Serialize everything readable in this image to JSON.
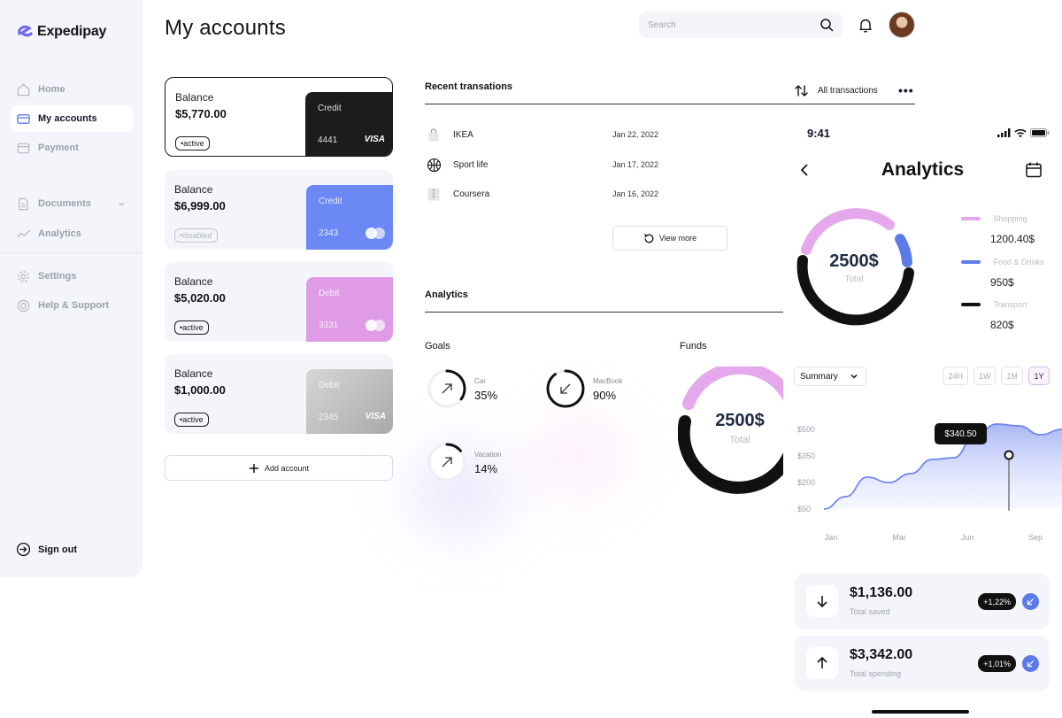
{
  "app": {
    "name": "Expedipay"
  },
  "sidebar": {
    "items": [
      {
        "label": "Home"
      },
      {
        "label": "My accounts"
      },
      {
        "label": "Payment"
      },
      {
        "label": "Documents"
      },
      {
        "label": "Analytics"
      },
      {
        "label": "Settings"
      },
      {
        "label": "Help & Support"
      }
    ],
    "sign_out": "Sign out"
  },
  "header": {
    "title": "My accounts",
    "search_placeholder": "Search"
  },
  "accounts": [
    {
      "balance_label": "Balance",
      "balance": "$5,770.00",
      "status": "•active",
      "type": "Credit",
      "number": "4441",
      "brand": "VISA",
      "color": "#1c1c1e"
    },
    {
      "balance_label": "Balance",
      "balance": "$6,999.00",
      "status": "•disabled",
      "type": "Credit",
      "number": "2343",
      "brand": "mastercard",
      "color": "#6b88f5"
    },
    {
      "balance_label": "Balance",
      "balance": "$5,020.00",
      "status": "•active",
      "type": "Debit",
      "number": "3331",
      "brand": "mastercard",
      "color": "#e09be6"
    },
    {
      "balance_label": "Balance",
      "balance": "$1,000.00",
      "status": "•active",
      "type": "Debit",
      "number": "2345",
      "brand": "VISA",
      "color": "#c2c2c2"
    }
  ],
  "add_account": "Add account",
  "transactions": {
    "title": "Recent transations",
    "all_label": "All transactions",
    "rows": [
      {
        "name": "IKEA",
        "date": "Jan 22, 2022",
        "icon": "shopping-bag-icon"
      },
      {
        "name": "Sport life",
        "date": "Jan 17, 2022",
        "icon": "basketball-icon"
      },
      {
        "name": "Coursera",
        "date": "Jan 16, 2022",
        "icon": "book-icon"
      }
    ],
    "view_more": "View more"
  },
  "analytics": {
    "title": "Analytics",
    "goals_title": "Goals",
    "goals": [
      {
        "name": "Car",
        "pct": "35%",
        "value": 0.35
      },
      {
        "name": "MacBook",
        "pct": "90%",
        "value": 0.9
      },
      {
        "name": "Vacation",
        "pct": "14%",
        "value": 0.14
      }
    ],
    "funds_title": "Funds",
    "funds_value": "2500$",
    "funds_sub": "Total"
  },
  "phone": {
    "time": "9:41",
    "title": "Analytics",
    "total_value": "2500$",
    "total_label": "Total",
    "legend": [
      {
        "name": "Shopping",
        "value": "1200.40$",
        "color": "#e3a6ea"
      },
      {
        "name": "Food & Drinks",
        "value": "950$",
        "color": "#5b7be8"
      },
      {
        "name": "Transport",
        "value": "820$",
        "color": "#111111"
      }
    ],
    "summary_label": "Summary",
    "ranges": [
      "24H",
      "1W",
      "1M",
      "1Y"
    ],
    "active_range": "1Y",
    "tooltip": "$340.50",
    "stats": [
      {
        "value": "$1,136.00",
        "label": "Total saved",
        "change": "+1,22%"
      },
      {
        "value": "$3,342.00",
        "label": "Total spending",
        "change": "+1,01%"
      }
    ]
  },
  "chart_data": {
    "type": "area",
    "x": [
      "Jan",
      "Mar",
      "Jun",
      "Sep"
    ],
    "y_ticks": [
      "$500",
      "$350",
      "$200",
      "$50"
    ],
    "ylim": [
      50,
      500
    ],
    "series": [
      {
        "values": [
          50,
          120,
          230,
          200,
          250,
          330,
          340,
          470,
          530,
          520,
          470,
          500
        ]
      }
    ],
    "highlight": {
      "x": "Jun",
      "label": "$340.50"
    }
  }
}
